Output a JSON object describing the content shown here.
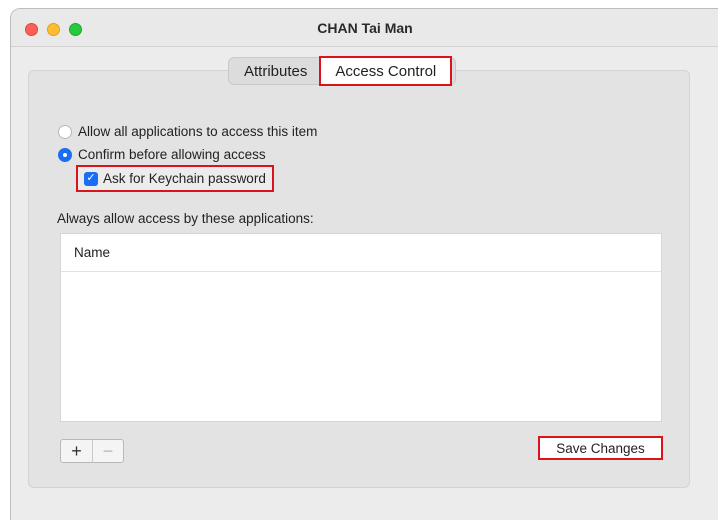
{
  "window": {
    "title": "CHAN Tai Man"
  },
  "tabs": [
    {
      "label": "Attributes",
      "selected": false
    },
    {
      "label": "Access Control",
      "selected": true
    }
  ],
  "access": {
    "options": [
      {
        "label": "Allow all applications to access this item",
        "selected": false
      },
      {
        "label": "Confirm before allowing access",
        "selected": true
      }
    ],
    "keychain_checkbox": {
      "label": "Ask for Keychain password",
      "checked": true
    },
    "always_allow_label": "Always allow access by these applications:"
  },
  "table": {
    "columns": [
      "Name"
    ],
    "rows": []
  },
  "buttons": {
    "add": "+",
    "remove": "−",
    "save": "Save Changes"
  },
  "colors": {
    "accent": "#1a6ef5",
    "highlight_outline": "#d8141d",
    "close": "#ff5f57",
    "minimize": "#febc2e",
    "zoom": "#28c840"
  }
}
